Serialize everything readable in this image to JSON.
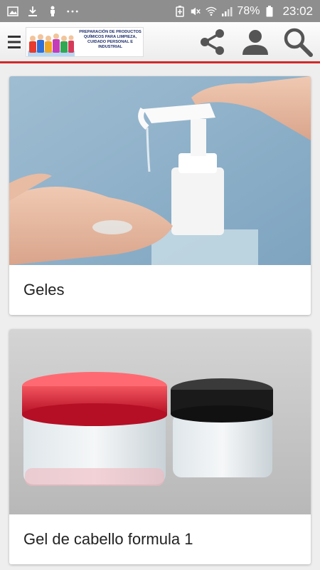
{
  "status_bar": {
    "battery_percent": "78%",
    "time": "23:02",
    "icons": [
      "image-icon",
      "download-icon",
      "figure-icon",
      "more-icon",
      "battery-saver-icon",
      "mute-icon",
      "wifi-icon",
      "signal-icon",
      "battery-icon"
    ]
  },
  "app_bar": {
    "logo_text": "PREPARACIÓN DE PRODUCTOS QUÍMICOS PARA LIMPIEZA, CUIDADO PERSONAL E INDUSTRIAL",
    "accent_color": "#d12a2a",
    "actions": [
      "share-icon",
      "account-icon",
      "search-icon"
    ]
  },
  "cards": [
    {
      "title": "Geles",
      "image": "hand-sanitizer-pump-photo"
    },
    {
      "title": "Gel de cabello formula 1",
      "image": "hair-gel-jars-photo"
    }
  ]
}
